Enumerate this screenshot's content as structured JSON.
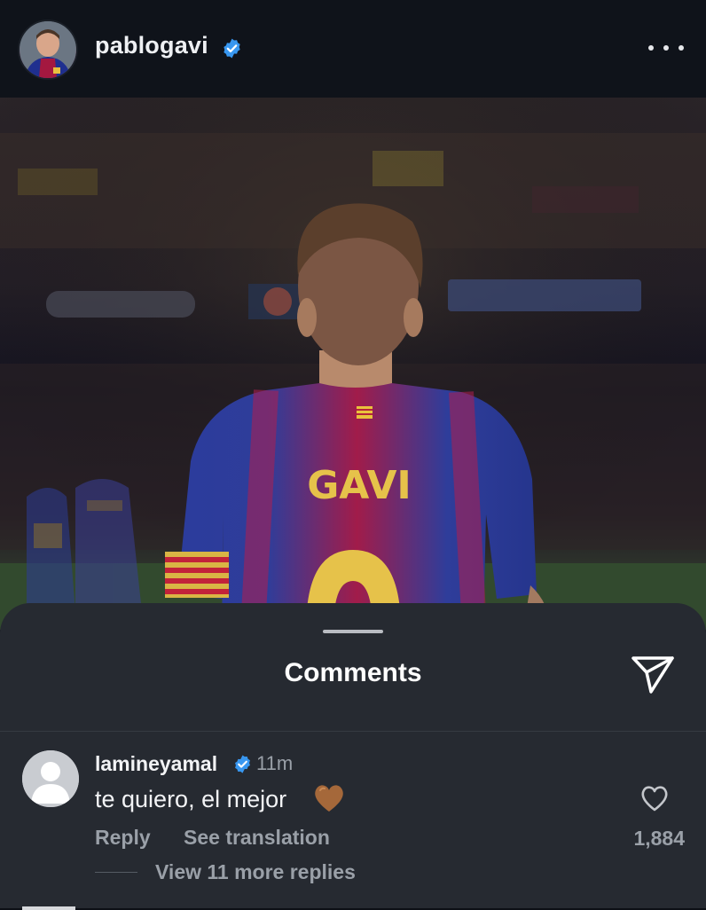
{
  "post": {
    "username": "pablogavi",
    "verified": true
  },
  "photo": {
    "jersey_name": "GAVI"
  },
  "comments_sheet": {
    "title": "Comments",
    "comment": {
      "username": "lamineyamal",
      "verified": true,
      "time": "11m",
      "text": "te quiero, el mejor",
      "emoji": "brown-heart",
      "reply_label": "Reply",
      "see_translation_label": "See translation",
      "like_count": "1,884",
      "view_replies_label": "View 11 more replies"
    }
  },
  "colors": {
    "background": "#0d1016",
    "sheet": "#262a31",
    "verified_blue": "#3897f0",
    "muted_text": "#9aa0a8",
    "heart_brown": "#a5683a"
  }
}
